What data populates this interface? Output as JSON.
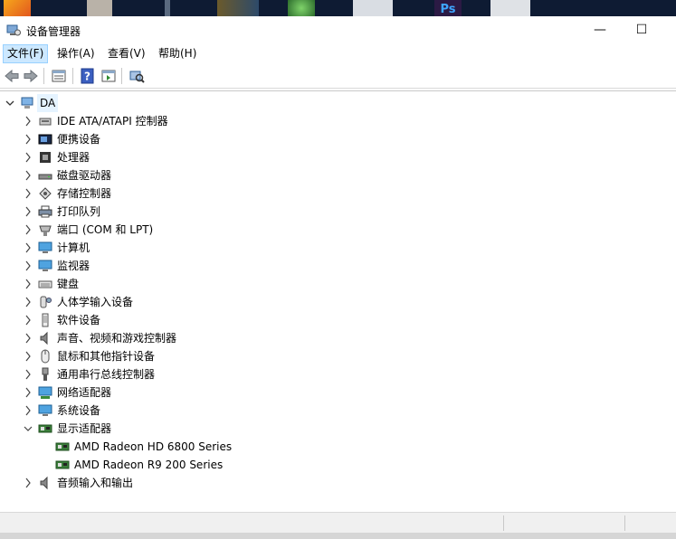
{
  "window": {
    "title": "设备管理器",
    "minimize": "—",
    "maximize": "☐",
    "close": "✕"
  },
  "menu": [
    {
      "label": "文件(F)"
    },
    {
      "label": "操作(A)"
    },
    {
      "label": "查看(V)"
    },
    {
      "label": "帮助(H)"
    }
  ],
  "tree": {
    "root": {
      "label": "DA"
    },
    "categories": [
      {
        "label": "IDE ATA/ATAPI 控制器",
        "icon": "ide-controller-icon"
      },
      {
        "label": "便携设备",
        "icon": "portable-device-icon"
      },
      {
        "label": "处理器",
        "icon": "processor-icon"
      },
      {
        "label": "磁盘驱动器",
        "icon": "disk-drive-icon"
      },
      {
        "label": "存储控制器",
        "icon": "storage-controller-icon"
      },
      {
        "label": "打印队列",
        "icon": "printer-icon"
      },
      {
        "label": "端口 (COM 和 LPT)",
        "icon": "port-icon"
      },
      {
        "label": "计算机",
        "icon": "computer-icon"
      },
      {
        "label": "监视器",
        "icon": "monitor-icon"
      },
      {
        "label": "键盘",
        "icon": "keyboard-icon"
      },
      {
        "label": "人体学输入设备",
        "icon": "hid-icon"
      },
      {
        "label": "软件设备",
        "icon": "software-device-icon"
      },
      {
        "label": "声音、视频和游戏控制器",
        "icon": "speaker-icon"
      },
      {
        "label": "鼠标和其他指针设备",
        "icon": "mouse-icon"
      },
      {
        "label": "通用串行总线控制器",
        "icon": "usb-icon"
      },
      {
        "label": "网络适配器",
        "icon": "network-adapter-icon"
      },
      {
        "label": "系统设备",
        "icon": "system-device-icon"
      },
      {
        "label": "显示适配器",
        "icon": "display-adapter-icon",
        "expanded": true,
        "children": [
          {
            "label": "AMD Radeon HD 6800 Series",
            "icon": "display-adapter-icon"
          },
          {
            "label": "AMD Radeon R9 200 Series",
            "icon": "display-adapter-icon"
          }
        ]
      },
      {
        "label": "音频输入和输出",
        "icon": "audio-io-icon"
      }
    ]
  },
  "colors": {
    "selection": "#e5f3ff",
    "menu_active": "#cce8ff",
    "taskbar": "#0e1b33"
  }
}
